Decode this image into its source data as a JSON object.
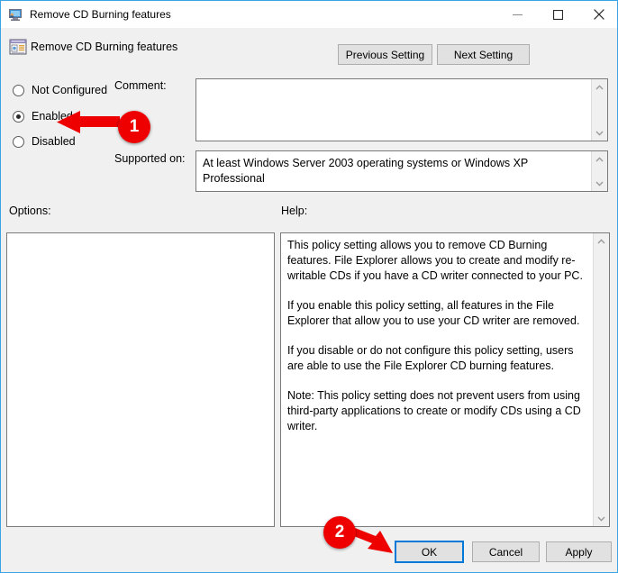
{
  "window": {
    "title": "Remove CD Burning features",
    "icon": "computer-monitor-icon",
    "controls": {
      "minimize": "minimize-icon",
      "maximize": "maximize-icon",
      "close": "close-icon"
    },
    "accent_color": "#3aa3e3",
    "chrome_color": "#f0f0f0"
  },
  "header": {
    "icon": "policy-setting-icon",
    "title": "Remove CD Burning features",
    "previous_setting_label": "Previous Setting",
    "next_setting_label": "Next Setting"
  },
  "state_options": {
    "selected": "Enabled",
    "items": [
      {
        "label": "Not Configured",
        "checked": false
      },
      {
        "label": "Enabled",
        "checked": true
      },
      {
        "label": "Disabled",
        "checked": false
      }
    ]
  },
  "comment": {
    "label": "Comment:",
    "value": "",
    "scroll_up_icon": "chevron-up-icon",
    "scroll_down_icon": "chevron-down-icon"
  },
  "supported_on": {
    "label": "Supported on:",
    "value": "At least Windows Server 2003 operating systems or Windows XP Professional",
    "scroll_up_icon": "chevron-up-icon",
    "scroll_down_icon": "chevron-down-icon"
  },
  "options_panel": {
    "label": "Options:",
    "value": ""
  },
  "help_panel": {
    "label": "Help:",
    "paragraphs": [
      "This policy setting allows you to remove CD Burning features. File Explorer allows you to create and modify re-writable CDs if you have a CD writer connected to your PC.",
      "If you enable this policy setting, all features in the File Explorer that allow you to use your CD writer are removed.",
      "If you disable or do not configure this policy setting, users are able to use the File Explorer CD burning features.",
      "Note: This policy setting does not prevent users from using third-party applications to create or modify CDs using a CD writer."
    ],
    "scroll_up_icon": "chevron-up-icon",
    "scroll_down_icon": "chevron-down-icon"
  },
  "footer": {
    "ok_label": "OK",
    "cancel_label": "Cancel",
    "apply_label": "Apply"
  },
  "annotations": {
    "color": "#ee0000",
    "markers": [
      {
        "number": "1",
        "points_to": "Enabled"
      },
      {
        "number": "2",
        "points_to": "OK"
      }
    ]
  }
}
